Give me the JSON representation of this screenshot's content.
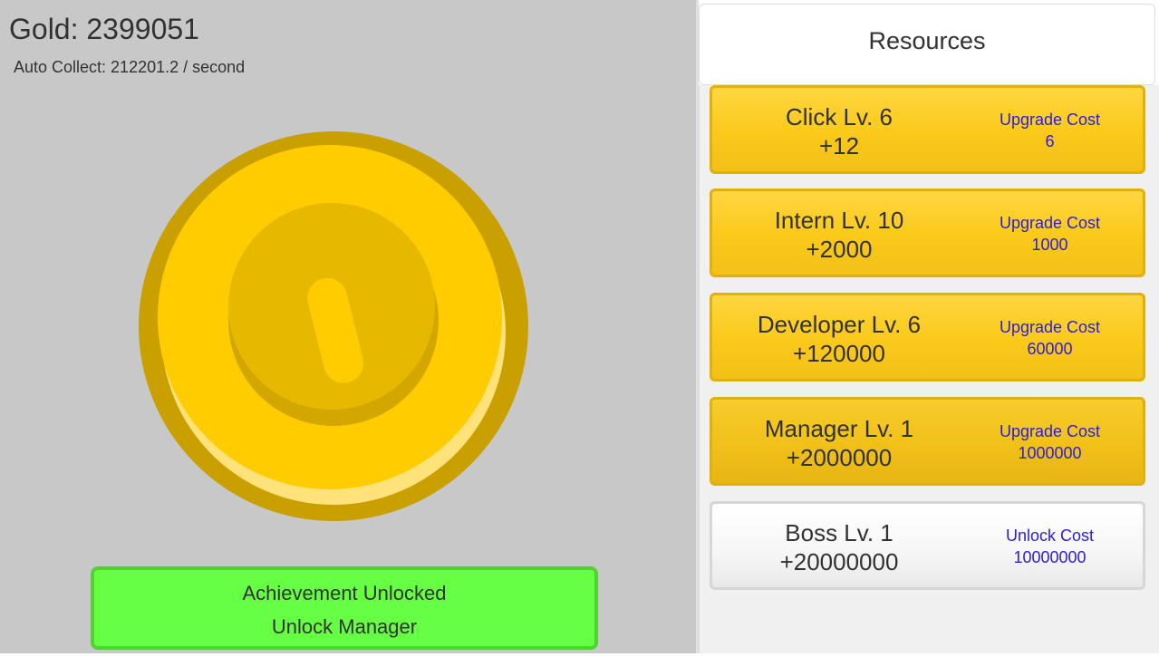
{
  "hud": {
    "gold_text": "Gold: 2399051",
    "auto_collect_text": "Auto Collect: 212201.2 / second"
  },
  "coin": {
    "icon": "gold-coin-icon",
    "colors": {
      "rim": "#c9a000",
      "face": "#ffcc00",
      "inner": "#e6b800",
      "highlight": "#ffe27a"
    }
  },
  "achievement": {
    "title": "Achievement Unlocked",
    "detail": "Unlock Manager",
    "color": "#66ff44"
  },
  "resources_panel": {
    "title": "Resources",
    "items": [
      {
        "name": "Click Lv. 6",
        "gain": "+12",
        "cost_label": "Upgrade Cost",
        "cost": "6",
        "locked": false
      },
      {
        "name": "Intern Lv. 10",
        "gain": "+2000",
        "cost_label": "Upgrade Cost",
        "cost": "1000",
        "locked": false
      },
      {
        "name": "Developer Lv. 6",
        "gain": "+120000",
        "cost_label": "Upgrade Cost",
        "cost": "60000",
        "locked": false
      },
      {
        "name": "Manager Lv. 1",
        "gain": "+2000000",
        "cost_label": "Upgrade Cost",
        "cost": "1000000",
        "locked": false
      },
      {
        "name": "Boss Lv. 1",
        "gain": "+20000000",
        "cost_label": "Unlock Cost",
        "cost": "10000000",
        "locked": true
      }
    ]
  }
}
